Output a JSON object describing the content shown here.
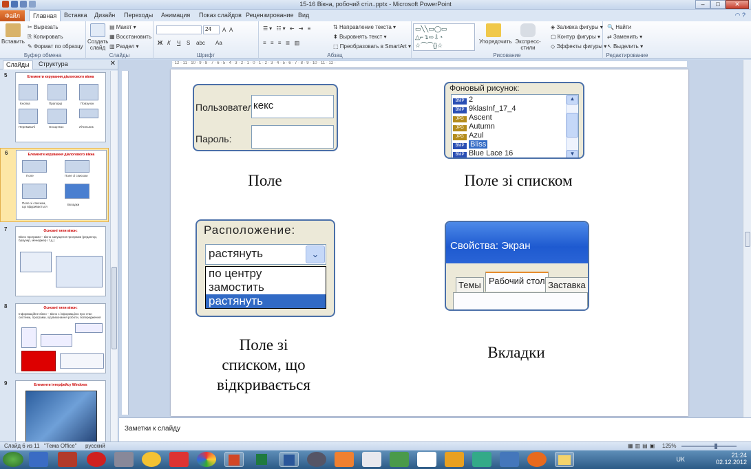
{
  "window": {
    "title": "15-16 Вікна, робочий стіл..pptx - Microsoft PowerPoint"
  },
  "ribbon_tabs": [
    "Файл",
    "Главная",
    "Вставка",
    "Дизайн",
    "Переходы",
    "Анимация",
    "Показ слайдов",
    "Рецензирование",
    "Вид"
  ],
  "clipboard": {
    "paste": "Вставить",
    "cut": "Вырезать",
    "copy": "Копировать",
    "format": "Формат по образцу",
    "label": "Буфер обмена"
  },
  "slides_group": {
    "new": "Создать слайд",
    "layout": "Макет",
    "reset": "Восстановить",
    "section": "Раздел",
    "label": "Слайды"
  },
  "font_group": {
    "size": "24",
    "label": "Шрифт",
    "bold": "Ж",
    "italic": "К",
    "underline": "Ч",
    "strike": "S",
    "spacing": "abc",
    "aa": "Aa",
    "grow": "A",
    "shrink": "A"
  },
  "paragraph_group": {
    "direction": "Направление текста",
    "align": "Выровнять текст",
    "smartart": "Преобразовать в SmartArt",
    "label": "Абзац"
  },
  "drawing_group": {
    "arrange": "Упорядочить",
    "styles": "Экспресс-стили",
    "fill": "Заливка фигуры",
    "outline": "Контур фигуры",
    "effects": "Эффекты фигуры",
    "label": "Рисование"
  },
  "editing_group": {
    "find": "Найти",
    "replace": "Заменить",
    "select": "Выделить",
    "label": "Редактирование"
  },
  "pane": {
    "tab_slides": "Слайды",
    "tab_outline": "Структура"
  },
  "thumbs": [
    {
      "num": "5",
      "title": "Елементи керування діалогового вікна",
      "labels": [
        "Кнопка",
        "Прапорці",
        "Повзунок",
        "Перемикачі",
        "Group Box",
        "Лічильник"
      ]
    },
    {
      "num": "6",
      "title": "Елементи керування діалогового вікна",
      "labels": [
        "Поле",
        "Поле зі списком",
        "Поле зі списком, що відкривається",
        "Вкладки"
      ]
    },
    {
      "num": "7",
      "title": "Основні типи вікон:",
      "labels": [
        "Вікно програми – вікно запущеної програми (редактор, браузер, менеджер і т.д.)"
      ]
    },
    {
      "num": "8",
      "title": "Основні типи вікон:",
      "labels": [
        "Інформаційне вікно – вікно з інформацією про стан системи, програми, хід виконання роботи, попередження"
      ]
    },
    {
      "num": "9",
      "title": "Елементи інтерфейсу Windows",
      "labels": []
    }
  ],
  "slide": {
    "user_label": "Пользователь:",
    "user_value": "кекс",
    "password_label": "Пароль:",
    "caption_field": "Поле",
    "list_title": "Фоновый рисунок:",
    "list_items": [
      {
        "badge": "BMP",
        "name": "2"
      },
      {
        "badge": "BMP",
        "name": "9klasInf_17_4"
      },
      {
        "badge": "JPG",
        "name": "Ascent"
      },
      {
        "badge": "JPG",
        "name": "Autumn"
      },
      {
        "badge": "JPG",
        "name": "Azul"
      },
      {
        "badge": "BMP",
        "name": "Bliss"
      },
      {
        "badge": "BMP",
        "name": "Blue Lace 16"
      }
    ],
    "caption_list": "Поле зі списком",
    "combo_title": "Расположение:",
    "combo_value": "растянуть",
    "combo_options": [
      "по центру",
      "замостить",
      "растянуть"
    ],
    "caption_combo": [
      "Поле зі",
      "списком, що",
      "відкривається"
    ],
    "props_title": "Свойства: Экран",
    "props_tabs": [
      "Темы",
      "Рабочий стол",
      "Заставка"
    ],
    "caption_tabs": "Вкладки"
  },
  "notes": {
    "placeholder": "Заметки к слайду"
  },
  "status": {
    "slide": "Слайд 6 из 11",
    "theme": "\"Тема Office\"",
    "lang": "русский",
    "zoom": "125%"
  },
  "tray": {
    "lang": "UK",
    "time": "21:24",
    "date": "02.12.2012"
  }
}
